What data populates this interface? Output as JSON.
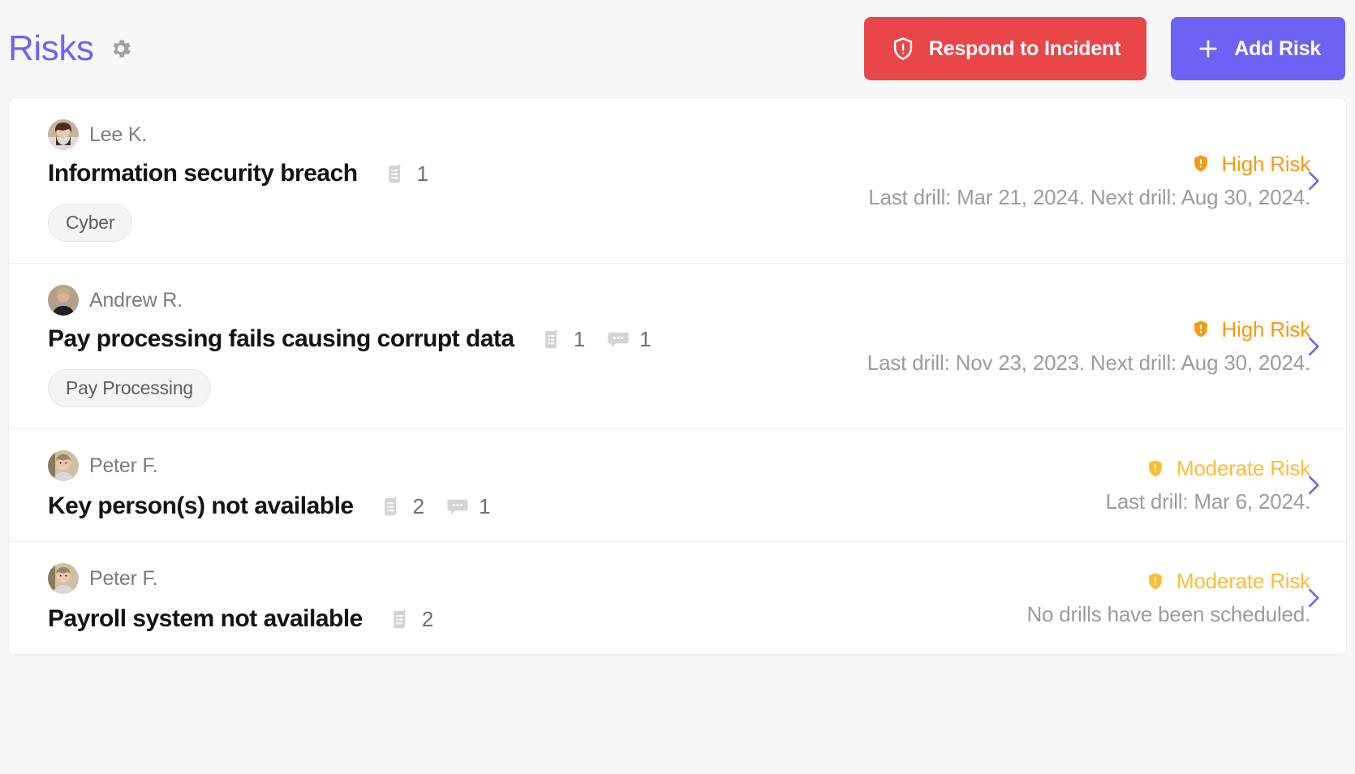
{
  "header": {
    "title": "Risks",
    "settings_icon": "gear-icon",
    "buttons": [
      {
        "label": "Respond to Incident",
        "icon": "shield-exclamation-icon",
        "color": "#e9464a"
      },
      {
        "label": "Add Risk",
        "icon": "plus-icon",
        "color": "#6c63f5"
      }
    ]
  },
  "colors": {
    "accent": "#6c63f5",
    "danger": "#e9464a",
    "high_risk": "#f59a12",
    "moderate_risk": "#fbbc34",
    "muted_text": "#9b9ba1"
  },
  "risks": [
    {
      "owner": "Lee K.",
      "avatar": "avatar-lee",
      "title": "Information security breach",
      "counts": [
        {
          "icon": "clipboard-list-icon",
          "value": "1"
        }
      ],
      "tag": "Cyber",
      "risk_level": "High Risk",
      "risk_icon": "shield-exclamation-filled-icon",
      "risk_color": "#f59a12",
      "drill_text": "Last drill: Mar 21, 2024. Next drill: Aug 30, 2024.",
      "chevron": "chevron-right-icon"
    },
    {
      "owner": "Andrew R.",
      "avatar": "avatar-andrew",
      "title": "Pay processing fails causing corrupt data",
      "counts": [
        {
          "icon": "clipboard-list-icon",
          "value": "1"
        },
        {
          "icon": "comment-icon",
          "value": "1"
        }
      ],
      "tag": "Pay Processing",
      "risk_level": "High Risk",
      "risk_icon": "shield-exclamation-filled-icon",
      "risk_color": "#f59a12",
      "drill_text": "Last drill: Nov 23, 2023. Next drill: Aug 30, 2024.",
      "chevron": "chevron-right-icon"
    },
    {
      "owner": "Peter F.",
      "avatar": "avatar-peter",
      "title": "Key person(s) not available",
      "counts": [
        {
          "icon": "clipboard-list-icon",
          "value": "2"
        },
        {
          "icon": "comment-icon",
          "value": "1"
        }
      ],
      "tag": null,
      "risk_level": "Moderate Risk",
      "risk_icon": "shield-exclamation-filled-icon",
      "risk_color": "#fbbc34",
      "drill_text": "Last drill: Mar 6, 2024.",
      "chevron": "chevron-right-icon"
    },
    {
      "owner": "Peter F.",
      "avatar": "avatar-peter",
      "title": "Payroll system not available",
      "counts": [
        {
          "icon": "clipboard-list-icon",
          "value": "2"
        }
      ],
      "tag": null,
      "risk_level": "Moderate Risk",
      "risk_icon": "shield-exclamation-filled-icon",
      "risk_color": "#fbbc34",
      "drill_text": "No drills have been scheduled.",
      "chevron": "chevron-right-icon"
    }
  ]
}
